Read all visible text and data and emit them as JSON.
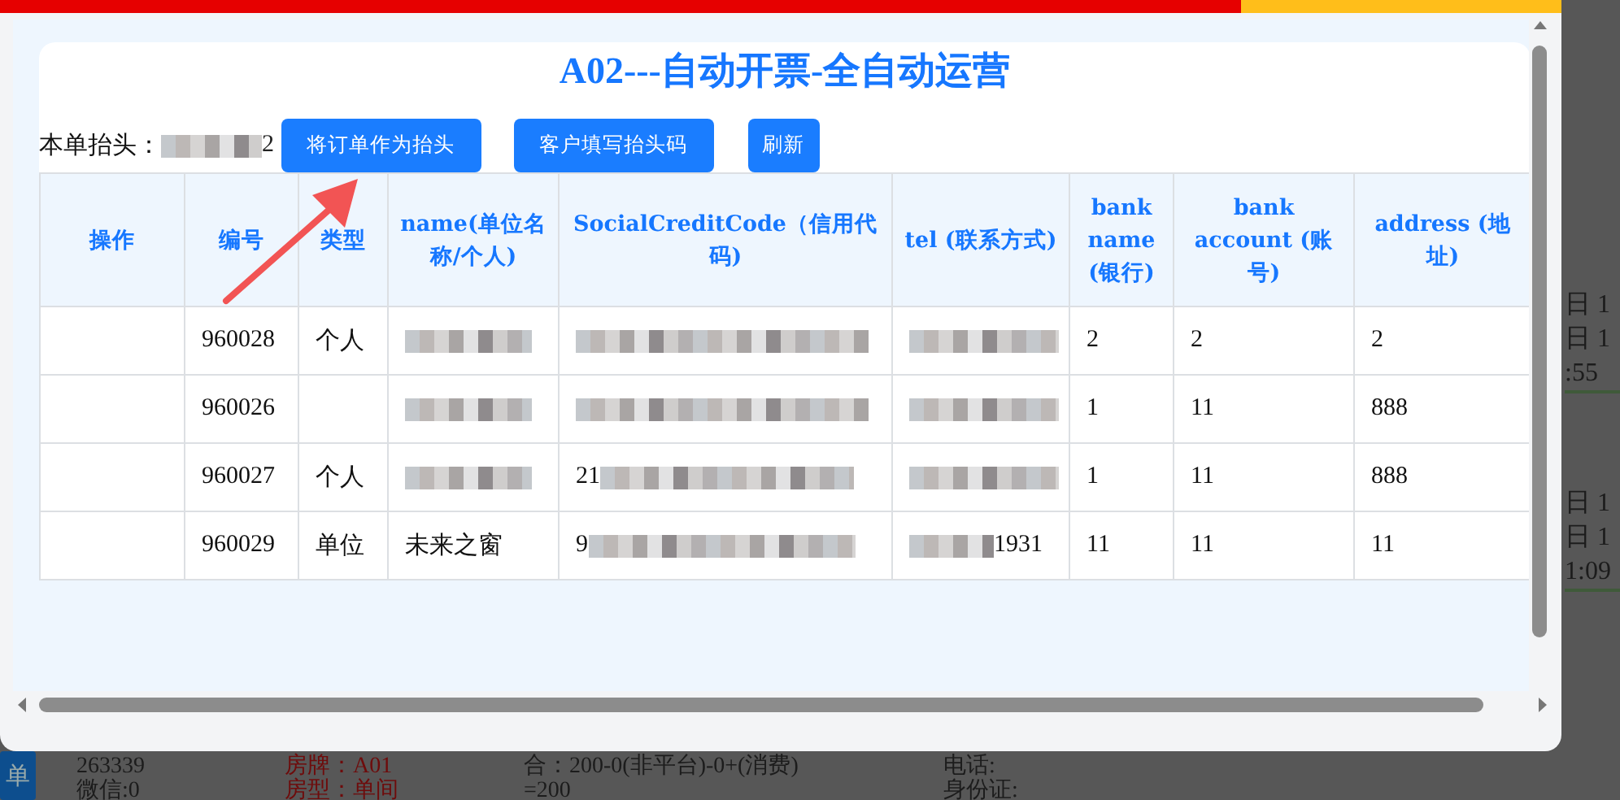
{
  "background_page": {
    "side_button": "单",
    "right_groups": [
      [
        "日 1",
        "日 1",
        ":55"
      ],
      [
        "日 1",
        "日 1",
        "1:09"
      ]
    ],
    "bottom_columns": [
      {
        "lines": [
          "263339",
          "微信:0"
        ],
        "color": "#1c1c1c"
      },
      {
        "lines": [
          "房牌：A01",
          "房型：单间"
        ],
        "color": "#6e0b0b"
      },
      {
        "lines": [
          "合：200-0(非平台)-0+(消费)",
          "=200"
        ],
        "color": "#1c1c1c"
      },
      {
        "lines": [
          "电话:",
          "身份证:"
        ],
        "color": "#1c1c1c"
      }
    ]
  },
  "dialog": {
    "title": "A02---自动开票-全自动运营",
    "header_label": "本单抬头：",
    "header_value": {
      "text": "2",
      "masked_before": true
    },
    "buttons": [
      "将订单作为抬头",
      "客户填写抬头码",
      "刷新"
    ],
    "table": {
      "columns": [
        "操作",
        "编号",
        "类型",
        "name(单位名称/个人)",
        "SocialCreditCode（信用代码)",
        "tel (联系方式)",
        "bank name (银行)",
        "bank account (账号)",
        "address (地址)"
      ],
      "rows": [
        {
          "cells": [
            {},
            {
              "text": "960028"
            },
            {
              "text": "个人"
            },
            {
              "masked_after": true
            },
            {
              "masked_after": true
            },
            {
              "masked_after": true
            },
            {
              "text": "2"
            },
            {
              "text": "2"
            },
            {
              "text": "2"
            }
          ]
        },
        {
          "cells": [
            {},
            {
              "text": "960026"
            },
            {},
            {
              "masked_after": true
            },
            {
              "masked_after": true
            },
            {
              "masked_after": true
            },
            {
              "text": "1"
            },
            {
              "text": "11"
            },
            {
              "text": "888"
            }
          ]
        },
        {
          "cells": [
            {},
            {
              "text": "960027"
            },
            {
              "text": "个人"
            },
            {
              "masked_after": true
            },
            {
              "text": "21",
              "masked_after": true
            },
            {
              "masked_after": true
            },
            {
              "text": "1"
            },
            {
              "text": "11"
            },
            {
              "text": "888"
            }
          ]
        },
        {
          "cells": [
            {},
            {
              "text": "960029"
            },
            {
              "text": "单位"
            },
            {
              "text": "未来之窗"
            },
            {
              "text": "9",
              "masked_after": true
            },
            {
              "text": "1931",
              "masked_before": true
            },
            {
              "text": "11"
            },
            {
              "text": "11"
            },
            {
              "text": "11"
            }
          ]
        }
      ]
    }
  }
}
